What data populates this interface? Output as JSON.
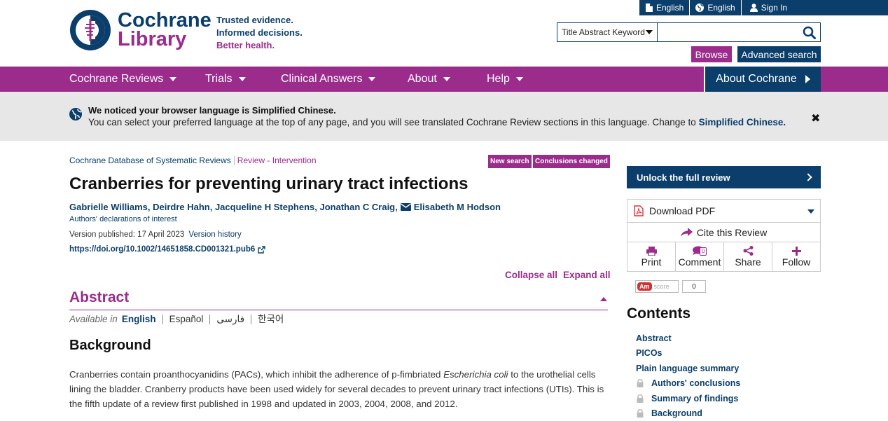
{
  "utilbar": {
    "lang_a": "English",
    "lang_b": "English",
    "signin": "Sign In"
  },
  "logo": {
    "word1": "Cochrane",
    "word2": "Library"
  },
  "tagline": {
    "line1": "Trusted evidence.",
    "line2": "Informed decisions.",
    "line3": "Better health."
  },
  "search": {
    "scope": "Title Abstract Keyword",
    "placeholder": "",
    "value": ""
  },
  "buttons": {
    "browse": "Browse",
    "advanced": "Advanced search"
  },
  "nav": {
    "items": [
      "Cochrane Reviews",
      "Trials",
      "Clinical Answers",
      "About",
      "Help"
    ],
    "about_cochrane": "About Cochrane"
  },
  "notice": {
    "title": "We noticed your browser language is Simplified Chinese.",
    "text": "You can select your preferred language at the top of any page, and you will see translated Cochrane Review sections in this language. Change to ",
    "link": "Simplified Chinese."
  },
  "article": {
    "breadcrumb_db": "Cochrane Database of Systematic Reviews",
    "breadcrumb_type": "Review - Intervention",
    "badge_new_search": "New search",
    "badge_conclusions": "Conclusions changed",
    "title": "Cranberries for preventing urinary tract infections",
    "authors": "Gabrielle Williams, Deirdre Hahn, Jacqueline H Stephens, Jonathan C Craig,",
    "corresponding_author": "Elisabeth M Hodson",
    "declarations": "Authors' declarations of interest",
    "version_published": "Version published: 17 April 2023",
    "version_history": "Version history",
    "doi": "https://doi.org/10.1002/14651858.CD001321.pub6",
    "collapse_all": "Collapse all",
    "expand_all": "Expand all"
  },
  "abstract": {
    "heading": "Abstract",
    "available_label": "Available in",
    "languages": [
      "English",
      "Español",
      "فارسی",
      "한국어"
    ],
    "background_heading": "Background",
    "background_before_italic": "Cranberries contain proanthocyanidins (PACs), which inhibit the adherence of p-fimbriated ",
    "background_italic": "Escherichia coli",
    "background_after_italic": " to the urothelial cells lining the bladder. Cranberry products have been used widely for several decades to prevent urinary tract infections (UTIs). This is the fifth update of a review first published in 1998 and updated in 2003, 2004, 2008, and 2012."
  },
  "sidebar": {
    "unlock": "Unlock the full review",
    "download_pdf": "Download PDF",
    "cite": "Cite this Review",
    "print": "Print",
    "comment": "Comment",
    "comment_count": "0",
    "share": "Share",
    "follow": "Follow",
    "altmetric_logo": "Am",
    "altmetric_label": "score",
    "altmetric_count": "0",
    "contents_heading": "Contents",
    "toc_open": [
      "Abstract",
      "PICOs",
      "Plain language summary"
    ],
    "toc_locked": [
      "Authors' conclusions",
      "Summary of findings",
      "Background"
    ]
  },
  "colors": {
    "brand_blue": "#0b3e6b",
    "brand_purple": "#9b2c8c"
  }
}
